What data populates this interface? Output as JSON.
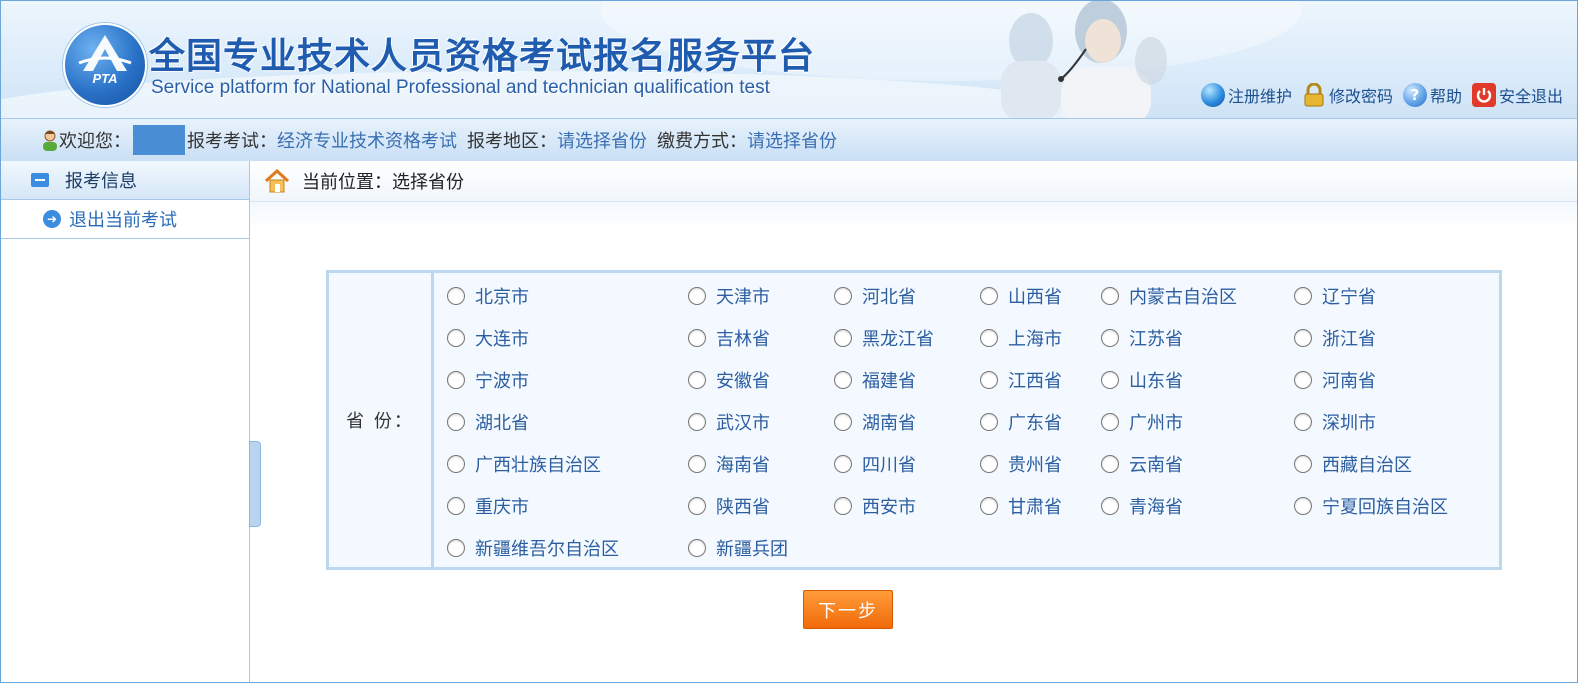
{
  "header": {
    "title": "全国专业技术人员资格考试报名服务平台",
    "subtitle": "Service platform for National Professional and technician qualification test",
    "logo_text": "PTA",
    "links": [
      {
        "label": "注册维护",
        "icon": "globe-icon"
      },
      {
        "label": "修改密码",
        "icon": "lock-icon"
      },
      {
        "label": "帮助",
        "icon": "help-icon"
      },
      {
        "label": "安全退出",
        "icon": "power-icon"
      }
    ]
  },
  "welcome": {
    "greeting": "欢迎您：",
    "exam_label": "报考考试：",
    "exam_value": "经济专业技术资格考试",
    "region_label": "报考地区：",
    "region_value": "请选择省份",
    "payment_label": "缴费方式：",
    "payment_value": "请选择省份"
  },
  "sidebar": {
    "header": "报考信息",
    "items": [
      {
        "label": "退出当前考试"
      }
    ]
  },
  "breadcrumb": {
    "text": "当前位置：选择省份"
  },
  "province": {
    "label": "省 份：",
    "options": [
      "北京市",
      "天津市",
      "河北省",
      "山西省",
      "内蒙古自治区",
      "辽宁省",
      "大连市",
      "吉林省",
      "黑龙江省",
      "上海市",
      "江苏省",
      "浙江省",
      "宁波市",
      "安徽省",
      "福建省",
      "江西省",
      "山东省",
      "河南省",
      "湖北省",
      "武汉市",
      "湖南省",
      "广东省",
      "广州市",
      "深圳市",
      "广西壮族自治区",
      "海南省",
      "四川省",
      "贵州省",
      "云南省",
      "西藏自治区",
      "重庆市",
      "陕西省",
      "西安市",
      "甘肃省",
      "青海省",
      "宁夏回族自治区",
      "新疆维吾尔自治区",
      "新疆兵团"
    ]
  },
  "next_button": "下一步",
  "colors": {
    "brand_blue": "#1f5cb0",
    "accent_orange": "#f16a0a",
    "border_blue": "#bcd8f0"
  }
}
